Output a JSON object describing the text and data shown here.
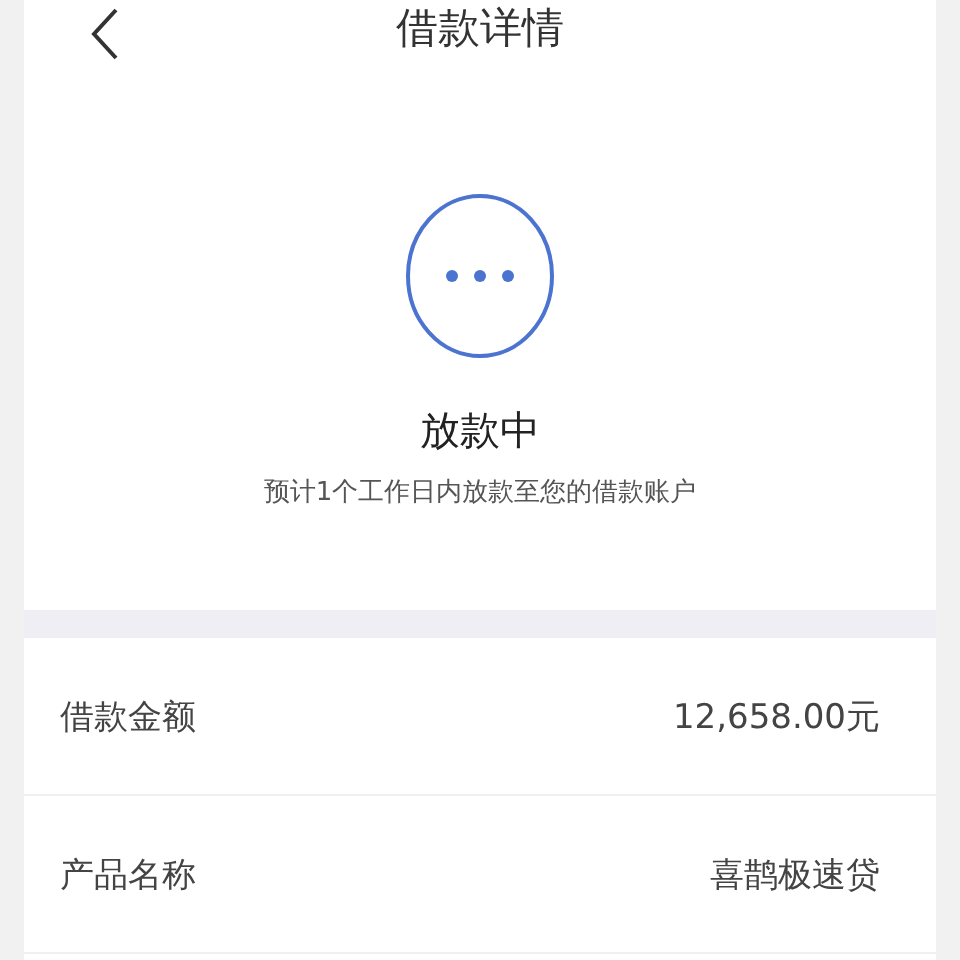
{
  "header": {
    "title": "借款详情"
  },
  "status": {
    "kind": "pending",
    "title": "放款中",
    "subtitle": "预计1个工作日内放款至您的借款账户"
  },
  "details": [
    {
      "label": "借款金额",
      "value": "12,658.00元"
    },
    {
      "label": "产品名称",
      "value": "喜鹊极速贷"
    }
  ]
}
